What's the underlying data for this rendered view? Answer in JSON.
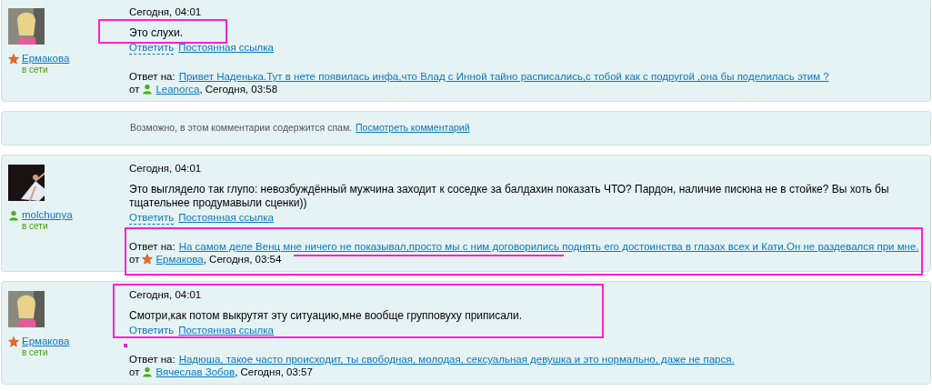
{
  "items": [
    {
      "kind": "comment",
      "avatar": {
        "kind": "picture"
      },
      "author": {
        "name": "Ермакова",
        "icon": {
          "kind": "star"
        },
        "status": "в сети"
      },
      "date": "Сегодня, 04:01",
      "text": "Это слухи.",
      "actions": [
        "Ответить",
        "Постоянная ссылка"
      ],
      "reply": {
        "label": "Ответ на:",
        "link": "Привет Наденька.Тут в нете появилась инфа,что Влад с Инной тайно расписались,с тобой как с подругой ,она бы поделилась этим ?",
        "from": "от",
        "author": "Leanorca",
        "icon": {
          "kind": "user"
        },
        "time": ", Сегодня, 03:58"
      },
      "marks": [
        {
          "kind": "body-box"
        }
      ]
    },
    {
      "kind": "spam",
      "text": "Возможно, в этом комментарии содержится спам.",
      "link": "Посмотреть комментарий"
    },
    {
      "kind": "comment",
      "avatar": {
        "kind": "picture"
      },
      "author": {
        "name": "molchunya",
        "icon": {
          "kind": "user"
        },
        "status": "в сети"
      },
      "date": "Сегодня, 04:01",
      "text": "Это выглядело так глупо: невозбуждённый мужчина заходит к соседке за балдахин показать ЧТО? Пардон, наличие писюна не в стойке? Вы хоть бы тщательнее продумавыли сценки))",
      "actions": [
        "Ответить",
        "Постоянная ссылка"
      ],
      "reply": {
        "label": "Ответ на:",
        "link": "На самом деле Венц мне ничего не показывал,просто мы с ним договорились поднять его достоинства в глазах всех и Кати.Он не раздевался при мне.",
        "from": "от",
        "author": "Ермакова",
        "icon": {
          "kind": "star"
        },
        "time": ", Сегодня, 03:54"
      },
      "marks": [
        {
          "kind": "reply-box"
        },
        {
          "kind": "underline"
        }
      ]
    },
    {
      "kind": "comment",
      "avatar": {
        "kind": "picture"
      },
      "author": {
        "name": "Ермакова",
        "icon": {
          "kind": "star"
        },
        "status": "в сети"
      },
      "date": "Сегодня, 04:01",
      "text": "Смотри,как потом выкрутят эту ситуацию,мне вообще групповуху приписали.",
      "actions": [
        "Ответить",
        "Постоянная ссылка"
      ],
      "reply": {
        "label": "Ответ на:",
        "link": "Надюша, такое часто происходит, ты свободная, молодая, сексуальная девушка и это нормально, даже не парся.",
        "from": "от",
        "author": "Вячеслав Зобов",
        "icon": {
          "kind": "user"
        },
        "time": ", Сегодня, 03:57"
      },
      "marks": [
        {
          "kind": "main-box"
        },
        {
          "kind": "dot"
        }
      ]
    }
  ]
}
